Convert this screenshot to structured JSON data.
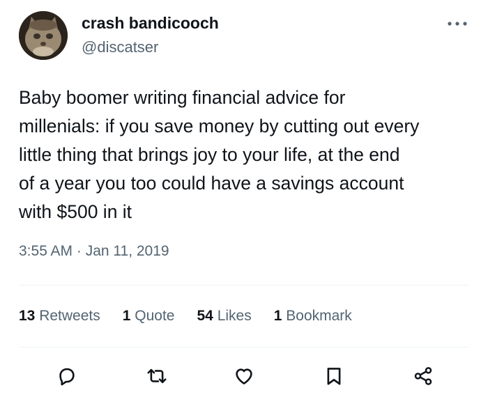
{
  "author": {
    "display_name": "crash bandicooch",
    "handle": "@discatser",
    "avatar_icon": "cat-avatar"
  },
  "tweet": {
    "text": "Baby boomer writing financial advice for\nmillenials: if you save money by cutting out every\nlittle thing that brings joy to your life, at the end\nof a year you too could have a savings account\nwith $500 in it",
    "timestamp": "3:55 AM · Jan 11, 2019"
  },
  "stats": {
    "retweets": {
      "count": "13",
      "label": "Retweets"
    },
    "quotes": {
      "count": "1",
      "label": "Quote"
    },
    "likes": {
      "count": "54",
      "label": "Likes"
    },
    "bookmarks": {
      "count": "1",
      "label": "Bookmark"
    }
  },
  "actions": {
    "icons": [
      "reply-icon",
      "retweet-icon",
      "like-icon",
      "bookmark-icon",
      "share-icon"
    ]
  },
  "colors": {
    "primary_text": "#0f1419",
    "secondary_text": "#536471",
    "divider": "#eff3f4"
  }
}
